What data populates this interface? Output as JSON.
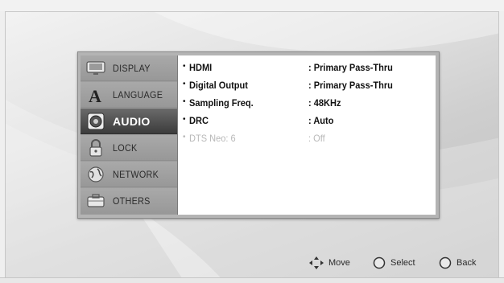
{
  "menu": [
    {
      "label": "DISPLAY",
      "icon": "display-icon",
      "active": false
    },
    {
      "label": "LANGUAGE",
      "icon": "language-icon",
      "active": false
    },
    {
      "label": "AUDIO",
      "icon": "speaker-icon",
      "active": true
    },
    {
      "label": "LOCK",
      "icon": "lock-icon",
      "active": false
    },
    {
      "label": "NETWORK",
      "icon": "globe-icon",
      "active": false
    },
    {
      "label": "OTHERS",
      "icon": "box-icon",
      "active": false
    }
  ],
  "settings": [
    {
      "bullet": "•",
      "name": "HDMI",
      "value": ": Primary Pass-Thru",
      "enabled": true
    },
    {
      "bullet": "•",
      "name": "Digital Output",
      "value": ": Primary Pass-Thru",
      "enabled": true
    },
    {
      "bullet": "•",
      "name": "Sampling Freq.",
      "value": ": 48KHz",
      "enabled": true
    },
    {
      "bullet": "•",
      "name": "DRC",
      "value": ": Auto",
      "enabled": true
    },
    {
      "bullet": "•",
      "name": "DTS Neo: 6",
      "value": ": Off",
      "enabled": false
    }
  ],
  "hints": {
    "move": "Move",
    "select": "Select",
    "back": "Back"
  },
  "colors": {
    "active_menu": "#3c3c3c",
    "menu_bg": "#9d9d9d",
    "content_bg": "#ffffff",
    "disabled_text": "#b8b8b8"
  }
}
